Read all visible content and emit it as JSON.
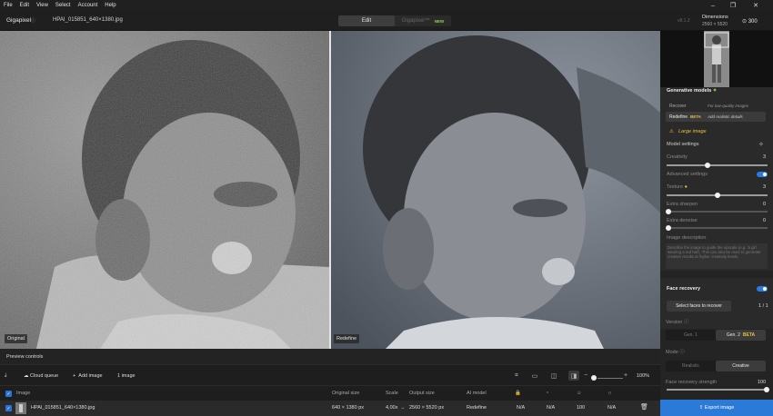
{
  "menu": [
    "File",
    "Edit",
    "View",
    "Select",
    "Account",
    "Help"
  ],
  "window_controls": {
    "minimize": "–",
    "restore": "❐",
    "close": "✕"
  },
  "topbar": {
    "brand": "Gigapixel",
    "info_icon": "ⓘ",
    "filename": "HPAI_015851_640×1380.jpg",
    "modes": {
      "edit": "Edit",
      "gigapixel": "Gigapixel™",
      "new": "NEW"
    },
    "version": "v8.1.2",
    "dimensions_label": "Dimensions",
    "dimensions_value": "2560 × 5520",
    "credits": "300"
  },
  "viewer": {
    "left_tag": "Original",
    "right_tag": "Redefine"
  },
  "preview_controls": "Preview controls",
  "queue": {
    "cloud_queue": "Cloud queue",
    "add_image": "Add image",
    "count": "1 image",
    "zoom": "100%"
  },
  "table": {
    "headers": {
      "image": "Image",
      "original_size": "Original size",
      "scale": "Scale",
      "output_size": "Output size",
      "ai_model": "AI model"
    },
    "row": {
      "name": "HPAI_015851_640×1380.jpg",
      "original_size": "640 × 1380 px",
      "scale": "4,00x",
      "arrow": "→",
      "output_size": "2560 × 5520 px",
      "ai_model": "Redefine",
      "c1": "N/A",
      "c2": "N/A",
      "c3": "100",
      "c4": "N/A"
    }
  },
  "sidebar": {
    "generative_title": "Generative models",
    "recover": {
      "label": "Recover",
      "desc": "For low-quality images"
    },
    "redefine": {
      "label": "Redefine",
      "beta": "BETA",
      "desc": "Add realistic details"
    },
    "warning": "Large image",
    "model_settings": "Model settings",
    "creativity": {
      "label": "Creativity",
      "value": "3",
      "fraction": 0.4
    },
    "advanced": "Advanced settings",
    "texture": {
      "label": "Texture",
      "value": "3",
      "fraction": 0.5
    },
    "sharpen": {
      "label": "Extra sharpen",
      "value": "0",
      "fraction": 0
    },
    "denoise": {
      "label": "Extra denoise",
      "value": "0",
      "fraction": 0
    },
    "image_description": "Image description",
    "description_placeholder": "Describe the image to guide the upscale (e.g. 'a girl wearing a red hat'). This can also be used to generate creative results at higher creativity levels.",
    "face_recovery": "Face recovery",
    "select_faces": "Select faces to recover",
    "faces_count": "1 / 1",
    "version": "Version",
    "gen1": "Gen. 1",
    "gen2": "Gen. 2",
    "gen2_beta": "BETA",
    "mode": "Mode",
    "realistic": "Realistic",
    "creative": "Creative",
    "strength": {
      "label": "Face recovery strength",
      "value": "100",
      "fraction": 1.0
    },
    "export": "Export image"
  },
  "colors": {
    "accent": "#2b7ad8",
    "beta": "#e6c23a",
    "new": "#8fd14f"
  }
}
